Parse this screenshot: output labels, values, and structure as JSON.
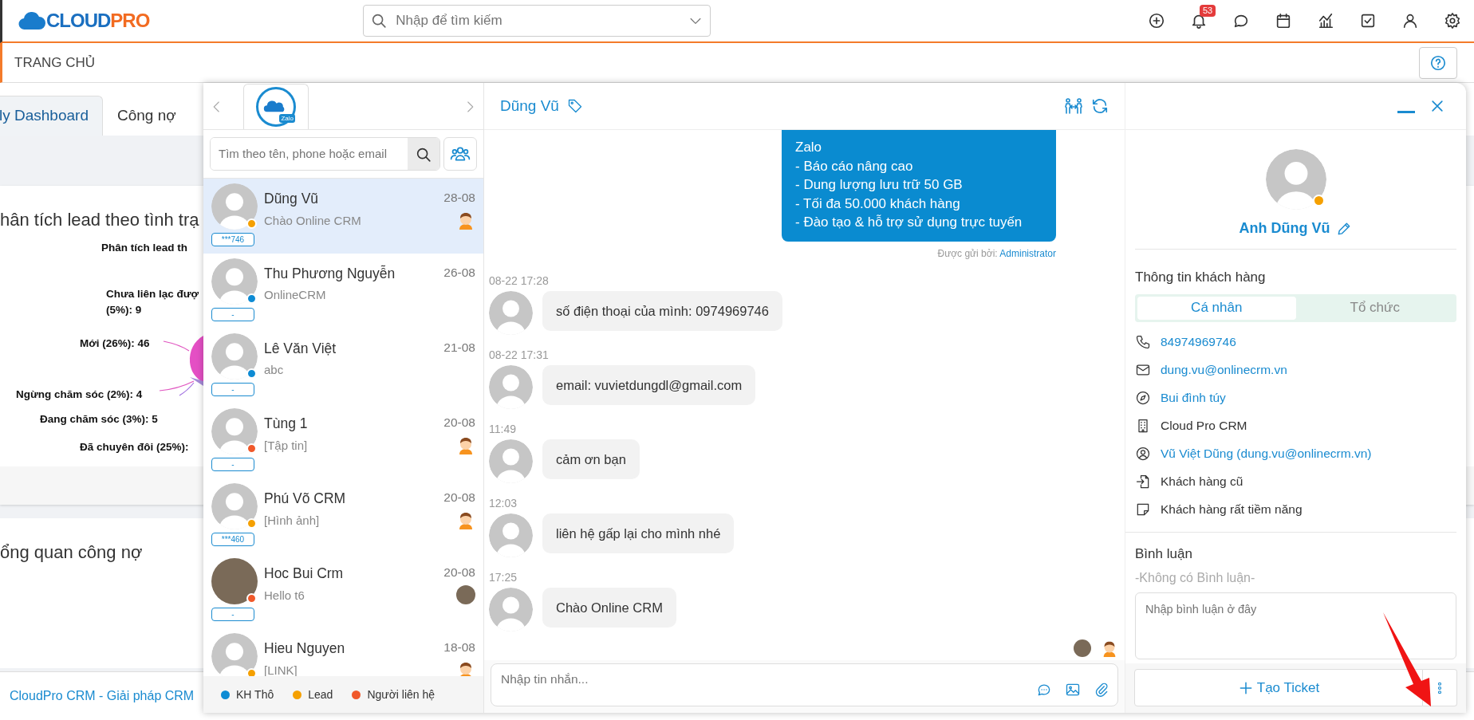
{
  "navbar": {
    "logo": {
      "main": "CLOUD",
      "accent": "PRO"
    },
    "search": {
      "placeholder": "Nhập để tìm kiếm"
    },
    "icons": [
      {
        "kind": "add"
      },
      {
        "kind": "notifications",
        "badge": "53"
      },
      {
        "kind": "messages"
      },
      {
        "kind": "calendar"
      },
      {
        "kind": "reports"
      },
      {
        "kind": "tasks"
      },
      {
        "kind": "profile"
      },
      {
        "kind": "settings"
      }
    ]
  },
  "breadcrumb": {
    "title": "TRANG CHỦ"
  },
  "dashboard": {
    "tabs": [
      {
        "label": "ly Dashboard",
        "selected": true
      },
      {
        "label": "Công nợ",
        "selected": false
      }
    ],
    "lead_card": {
      "title": "hân tích lead theo tình trạ",
      "chart_title": "Phân tích lead th",
      "labels": [
        {
          "lines": [
            "Chưa liên lạc đượ",
            "(5%): 9"
          ]
        },
        {
          "lines": [
            "Mới (26%): 46"
          ]
        },
        {
          "lines": [
            "Ngừng chăm sóc (2%): 4"
          ]
        },
        {
          "lines": [
            "Đang chăm sóc (3%): 5"
          ]
        },
        {
          "lines": [
            "Đã chuyên đôi (25%):"
          ]
        }
      ]
    },
    "debt_card": {
      "title": "ổng quan công nợ"
    },
    "footer": "CloudPro CRM - Giải pháp CRM"
  },
  "chat": {
    "channel_logo": {
      "badge": "Zalo"
    },
    "contact_search": {
      "placeholder": "Tìm theo tên, phone hoặc email"
    },
    "contacts": [
      {
        "name": "Dũng Vũ",
        "date": "28-08",
        "preview": "Chào Online CRM",
        "tag": "***746",
        "color": "#f5a000",
        "photo": false,
        "agent": {
          "photo": false
        },
        "selected": true
      },
      {
        "name": "Thu Phương Nguyễn",
        "date": "26-08",
        "preview": "OnlineCRM",
        "tag": "-",
        "color": "#0d8bd4",
        "photo": false,
        "selected": false
      },
      {
        "name": "Lê Văn Việt",
        "date": "21-08",
        "preview": "abc",
        "tag": "-",
        "color": "#0d8bd4",
        "photo": false,
        "selected": false
      },
      {
        "name": "Tùng 1",
        "date": "20-08",
        "preview": "[Tập tin]",
        "tag": "-",
        "color": "#f0582a",
        "photo": false,
        "agent": {
          "photo": false
        },
        "selected": false
      },
      {
        "name": "Phú Võ CRM",
        "date": "20-08",
        "preview": "[Hình ảnh]",
        "tag": "***460",
        "color": "#f5a000",
        "photo": false,
        "agent": {
          "photo": false
        },
        "selected": false
      },
      {
        "name": "Hoc Bui Crm",
        "date": "20-08",
        "preview": "Hello t6",
        "tag": "-",
        "color": "#f0582a",
        "photo": true,
        "agent": {
          "photo": true
        },
        "selected": false
      },
      {
        "name": "Hieu Nguyen",
        "date": "18-08",
        "preview": "[LINK]",
        "color": "#f5a000",
        "photo": false,
        "agent": {
          "photo": false
        },
        "selected": false
      }
    ],
    "legend": [
      {
        "label": "KH Thô",
        "color": "#0d8bd4"
      },
      {
        "label": "Lead",
        "color": "#f5a000"
      },
      {
        "label": "Người liên hệ",
        "color": "#f0582a"
      }
    ],
    "conversation": {
      "title": "Dũng Vũ",
      "messages": [
        {
          "kind": "outgoing",
          "lines": [
            "Zalo",
            "- Báo cáo nâng cao",
            "- Dung lượng lưu trữ 50 GB",
            "- Tối đa 50.000 khách hàng",
            "- Đào tạo & hỗ trợ sử dụng trực tuyến"
          ],
          "sent_by_label": "Được gửi bởi:",
          "sent_by": "Administrator"
        },
        {
          "kind": "incoming",
          "time": "08-22 17:28",
          "text": "số điện thoại của mình: 0974969746"
        },
        {
          "kind": "incoming",
          "time": "08-22 17:31",
          "text": "email: vuvietdungdl@gmail.com"
        },
        {
          "kind": "incoming",
          "time": "11:49",
          "text": "cảm ơn bạn"
        },
        {
          "kind": "incoming",
          "time": "12:03",
          "text": "liên hệ gấp lại cho mình nhé"
        },
        {
          "kind": "incoming",
          "time": "17:25",
          "text": "Chào Online CRM"
        }
      ],
      "seen_by": [
        {
          "photo": true
        },
        {
          "photo": false
        }
      ],
      "composer": {
        "placeholder": "Nhập tin nhắn..."
      }
    },
    "profile": {
      "name": "Anh Dũng Vũ",
      "color": "#f5a000",
      "section_title": "Thông tin khách hàng",
      "tabs": [
        {
          "label": "Cá nhân",
          "selected": true
        },
        {
          "label": "Tổ chức",
          "selected": false
        }
      ],
      "fields": [
        {
          "kind": "phone",
          "text": "84974969746",
          "link": true
        },
        {
          "kind": "email",
          "text": "dung.vu@onlinecrm.vn",
          "link": true
        },
        {
          "kind": "address",
          "text": "Bui đình túy",
          "link": true
        },
        {
          "kind": "company",
          "text": "Cloud Pro CRM",
          "link": false
        },
        {
          "kind": "owner",
          "text": "Vũ Việt Dũng (dung.vu@onlinecrm.vn)",
          "link": true
        },
        {
          "kind": "source",
          "text": "Khách hàng cũ",
          "link": false
        },
        {
          "kind": "rating",
          "text": "Khách hàng rất tiềm năng",
          "link": false
        }
      ],
      "comments": {
        "title": "Bình luận",
        "empty": "-Không có Bình luận-",
        "placeholder": "Nhập bình luận ở đây"
      },
      "ticket_button": "Tạo Ticket"
    }
  }
}
